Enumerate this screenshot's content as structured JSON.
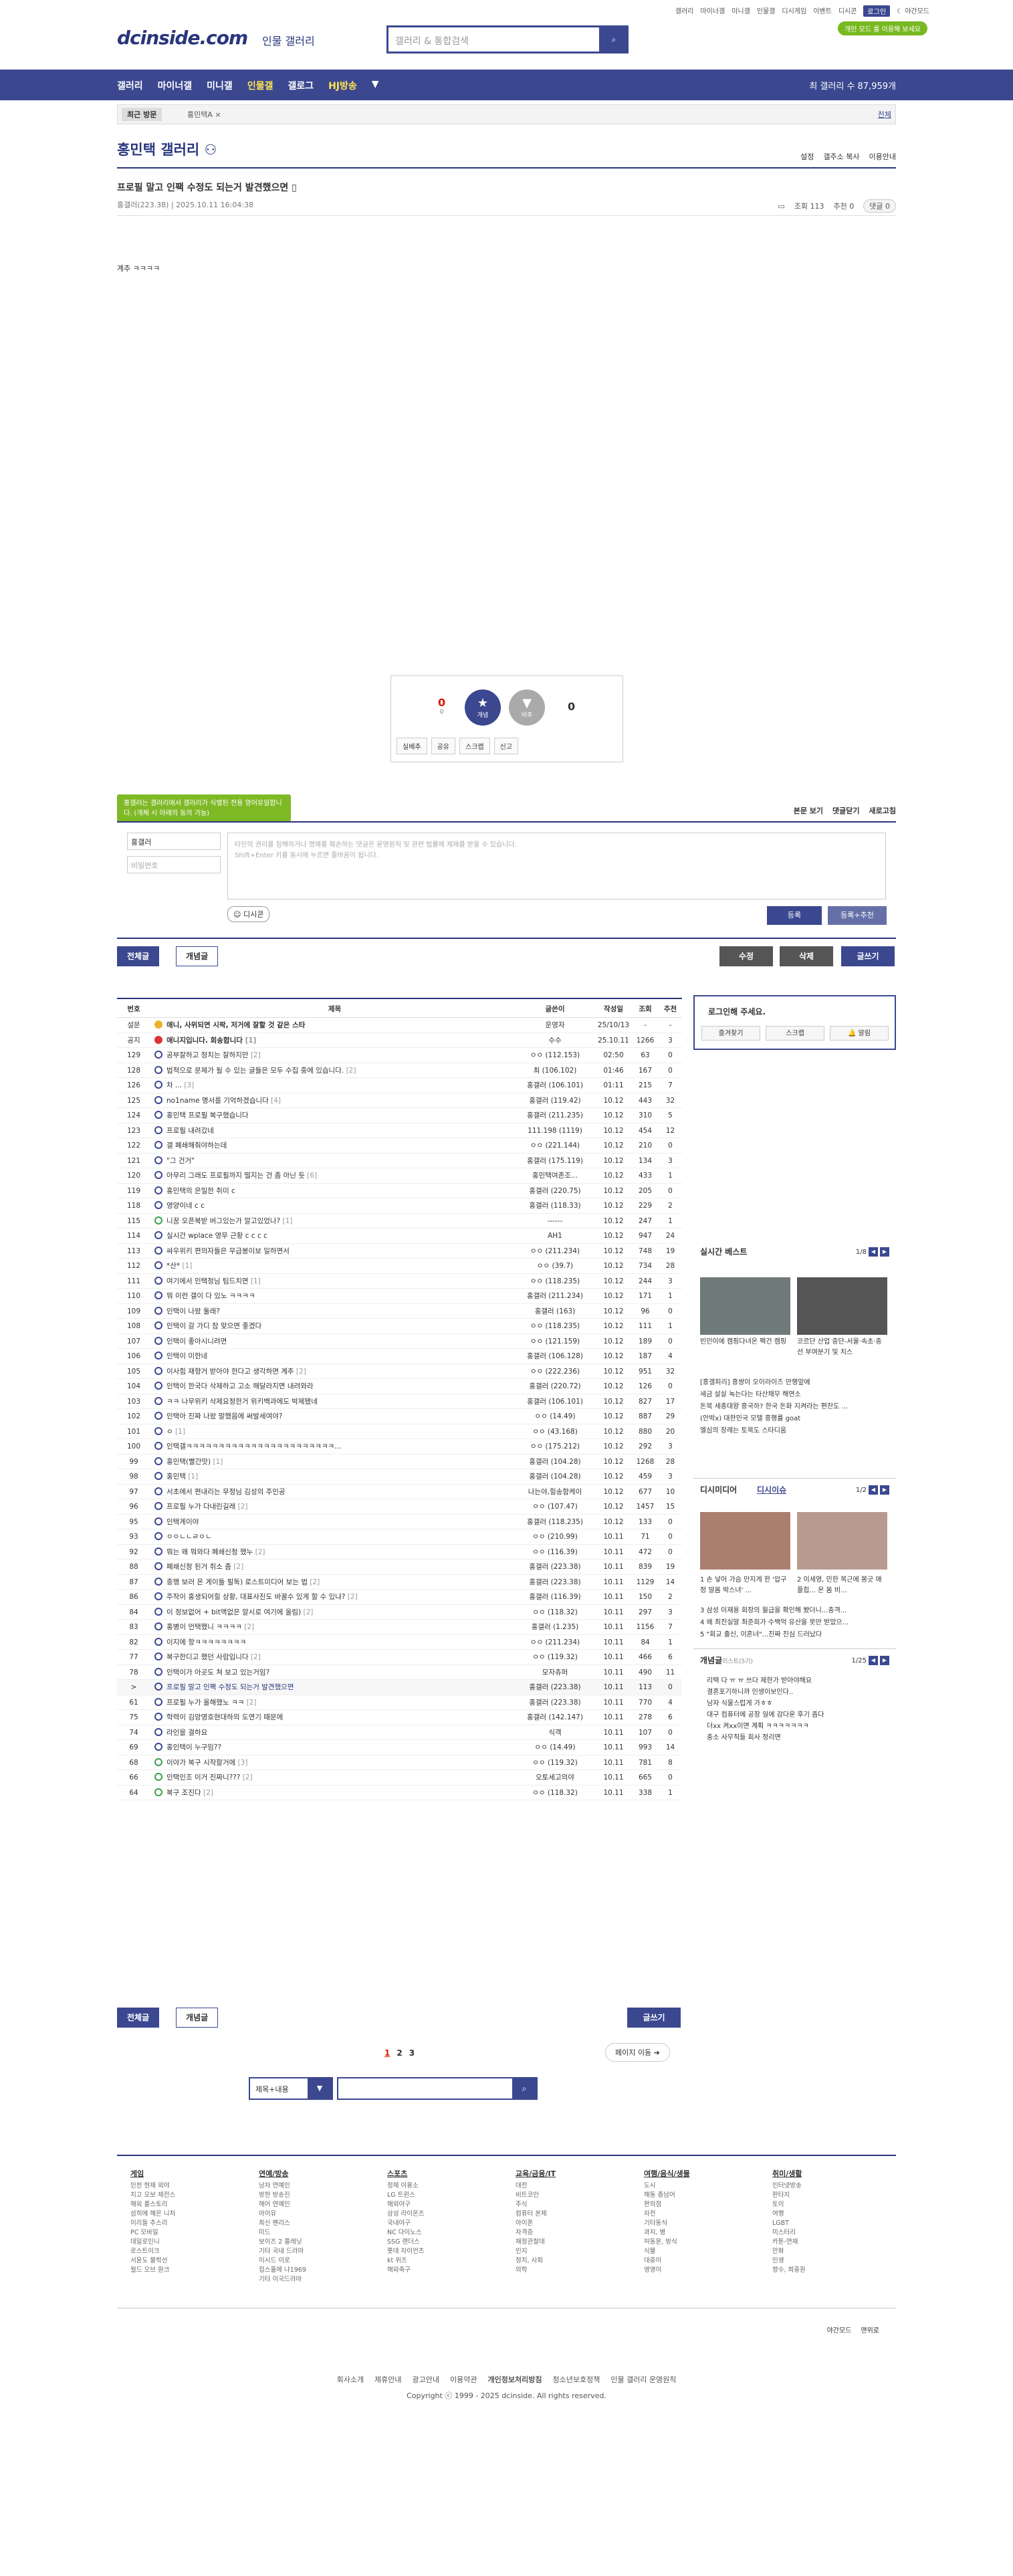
{
  "top": {
    "links": [
      "갤러리",
      "마이너갤",
      "미니갤",
      "인물갤",
      "디시게임",
      "이벤트",
      "디시콘"
    ],
    "login": "로그인",
    "night": "야간모드",
    "logo": "dcinside.com",
    "logo_sub": "인물 갤러리",
    "search_placeholder": "갤러리 & 통합검색",
    "badge": "개인 모드 를 이용해 보세요"
  },
  "nav": {
    "items": [
      "갤러리",
      "마이너갤",
      "미니갤",
      "인물갤",
      "갤로그",
      "HJ방송"
    ],
    "right": "최 갤러리 수 87,959개"
  },
  "subnav": {
    "recent": "최근 방문",
    "item": "홍민택A ×",
    "all": "전체"
  },
  "gallery": {
    "title": "홍민택 갤러리",
    "tools": [
      "설정",
      "갤주소 복사",
      "이용안내"
    ]
  },
  "post": {
    "title": "프로필 말고 인팩 수정도 되는거 발견했으면",
    "author": "홍갤러",
    "ip": "(223.38)",
    "date": "2025.10.11 16:04:38",
    "views": "조회 113",
    "recommend": "추천 0",
    "comments": "댓글 0",
    "body": "계추 ㅋㅋㅋㅋ"
  },
  "rec": {
    "up": "0",
    "up_fix": "0",
    "up_label": "개념",
    "down_label": "비추",
    "down": "0",
    "buttons": [
      "실베추",
      "공유",
      "스크랩",
      "신고"
    ]
  },
  "comment": {
    "tooltip": "홍갤러는 갤러리에서 갤러리가 식별된 전용 영어유일합니다. (개체 시 아래의 동의 가능)",
    "tools": [
      "본문 보기",
      "댓글닫기",
      "새로고침"
    ],
    "name": "홍갤러",
    "pw": "비밀번호",
    "placeholder": "타인의 권리를 침해하거나 명예를 훼손하는 댓글은 운영원칙 및 관련 법률에 제재를 받을 수 있습니다.\nShift+Enter 키를 동시에 누르면 줄바꿈이 됩니다.",
    "dccon": "디시콘",
    "register": "등록",
    "register2": "등록+추천"
  },
  "tabs": {
    "all": "전체글",
    "concept": "개념글",
    "edit": "수정",
    "delete": "삭제",
    "write": "글쓰기"
  },
  "table": {
    "headers": [
      "번호",
      "제목",
      "글쓴이",
      "작성일",
      "조회",
      "추천"
    ],
    "rows": [
      {
        "no": "설문",
        "icon": "o",
        "title": "애니, 사위되면 시팍, 저거에 잘할 것 같은 스타",
        "cmt": "",
        "writer": "운영자",
        "date": "25/10/13",
        "views": "-",
        "rec": "-",
        "b": true
      },
      {
        "no": "공지",
        "icon": "r",
        "title": "애니지입니다. 회송합니다",
        "cmt": "[1]",
        "writer": "수수",
        "date": "25.10.11",
        "views": "1266",
        "rec": "3",
        "b": true
      },
      {
        "no": "129",
        "icon": "",
        "title": "공부잘하고 정치는 잘하지만",
        "cmt": "[2]",
        "writer": "ㅇㅇ (112.153)",
        "date": "02:50",
        "views": "63",
        "rec": "0"
      },
      {
        "no": "128",
        "icon": "",
        "title": "법적으로 문제가 될 수 있는 글들은 모두 수집 중에 있습니다.",
        "cmt": "[2]",
        "writer": "최 (106.102)",
        "date": "01:46",
        "views": "167",
        "rec": "0"
      },
      {
        "no": "126",
        "icon": "",
        "title": "차 ...",
        "cmt": "[3]",
        "writer": "홍갤러 (106.101)",
        "date": "01:11",
        "views": "215",
        "rec": "7"
      },
      {
        "no": "125",
        "icon": "",
        "title": "no1name 명서를 기억하겠습니다",
        "cmt": "[4]",
        "writer": "홍갤러 (119.42)",
        "date": "10.12",
        "views": "443",
        "rec": "32"
      },
      {
        "no": "124",
        "icon": "",
        "title": "홍민택 프로필 복구했습니다",
        "cmt": "",
        "writer": "홍갤러 (211.235)",
        "date": "10.12",
        "views": "310",
        "rec": "5"
      },
      {
        "no": "123",
        "icon": "",
        "title": "프로필 내려갔네",
        "cmt": "",
        "writer": "111.198 (1119)",
        "date": "10.12",
        "views": "454",
        "rec": "12"
      },
      {
        "no": "122",
        "icon": "",
        "title": "갤 폐쇄해줘야하는데",
        "cmt": "",
        "writer": "ㅇㅇ (221.144)",
        "date": "10.12",
        "views": "210",
        "rec": "0"
      },
      {
        "no": "121",
        "icon": "",
        "title": "\"그 건거\"",
        "cmt": "",
        "writer": "홍갤러 (175.119)",
        "date": "10.12",
        "views": "134",
        "rec": "3"
      },
      {
        "no": "120",
        "icon": "",
        "title": "아무리 그래도 프로필까지 떨지는 건 좀 아닌 듯",
        "cmt": "[6]",
        "writer": "홍민택여존조...",
        "date": "10.12",
        "views": "433",
        "rec": "1"
      },
      {
        "no": "119",
        "icon": "",
        "title": "홍민택의 은밀한 취미 c",
        "cmt": "",
        "writer": "홍갤러 (220.75)",
        "date": "10.12",
        "views": "205",
        "rec": "0"
      },
      {
        "no": "118",
        "icon": "",
        "title": "영양이네 c c",
        "cmt": "",
        "writer": "홍갤러 (118.33)",
        "date": "10.12",
        "views": "229",
        "rec": "2"
      },
      {
        "no": "115",
        "icon": "g",
        "title": "니꿈 오픈북받 버그있는가 알고있었나?",
        "cmt": "[1]",
        "writer": "------",
        "date": "10.12",
        "views": "247",
        "rec": "1"
      },
      {
        "no": "114",
        "icon": "",
        "title": "실시간 wplace 영무 근황 c c c c",
        "cmt": "",
        "writer": "AH1",
        "date": "10.12",
        "views": "947",
        "rec": "24"
      },
      {
        "no": "113",
        "icon": "",
        "title": "싸우위키 편의자들은 무급봉이보 일하면서",
        "cmt": "",
        "writer": "ㅇㅇ (211.234)",
        "date": "10.12",
        "views": "748",
        "rec": "19"
      },
      {
        "no": "112",
        "icon": "",
        "title": "*산*",
        "cmt": "[1]",
        "writer": "ㅇㅇ (39.7)",
        "date": "10.12",
        "views": "734",
        "rec": "28"
      },
      {
        "no": "111",
        "icon": "",
        "title": "여기에서 인택정님 팀드치면",
        "cmt": "[1]",
        "writer": "ㅇㅇ (118.235)",
        "date": "10.12",
        "views": "244",
        "rec": "3"
      },
      {
        "no": "110",
        "icon": "",
        "title": "뭐 이런 갤이 다 있노 ㅋㅋㅋㅋ",
        "cmt": "",
        "writer": "홍갤러 (211.234)",
        "date": "10.12",
        "views": "171",
        "rec": "1"
      },
      {
        "no": "109",
        "icon": "",
        "title": "인택이 나왔 둘래?",
        "cmt": "",
        "writer": "홍갤러 (163)",
        "date": "10.12",
        "views": "96",
        "rec": "0"
      },
      {
        "no": "108",
        "icon": "",
        "title": "인택이 갈 가디 참 맞으면 좋겠다",
        "cmt": "",
        "writer": "ㅇㅇ (118.235)",
        "date": "10.12",
        "views": "111",
        "rec": "1"
      },
      {
        "no": "107",
        "icon": "",
        "title": "인택이 좋아시니려면",
        "cmt": "",
        "writer": "ㅇㅇ (121.159)",
        "date": "10.12",
        "views": "189",
        "rec": "0"
      },
      {
        "no": "106",
        "icon": "",
        "title": "인택이 미한네",
        "cmt": "",
        "writer": "홍갤러 (106.128)",
        "date": "10.12",
        "views": "187",
        "rec": "4"
      },
      {
        "no": "105",
        "icon": "",
        "title": "이사힘 재향거 받아야 한다고 생각하면 계추",
        "cmt": "[2]",
        "writer": "ㅇㅇ (222.236)",
        "date": "10.12",
        "views": "951",
        "rec": "32"
      },
      {
        "no": "104",
        "icon": "",
        "title": "인택이 한국다 삭제하고 고소 해달라지면 내려와라",
        "cmt": "",
        "writer": "홍갤러 (220.72)",
        "date": "10.12",
        "views": "126",
        "rec": "0"
      },
      {
        "no": "103",
        "icon": "",
        "title": "ㅋㅋ 나무위키 삭제요청한거 위키백과에도 박제됐네",
        "cmt": "",
        "writer": "홍갤러 (106.101)",
        "date": "10.12",
        "views": "827",
        "rec": "17"
      },
      {
        "no": "102",
        "icon": "",
        "title": "인택아 진짜 나왔 말했음에 써발세여야?",
        "cmt": "",
        "writer": "ㅇㅇ (14.49)",
        "date": "10.12",
        "views": "887",
        "rec": "29"
      },
      {
        "no": "101",
        "icon": "",
        "title": "ㅇ",
        "cmt": "[1]",
        "writer": "ㅇㅇ (43.168)",
        "date": "10.12",
        "views": "880",
        "rec": "20"
      },
      {
        "no": "100",
        "icon": "",
        "title": "인택갤ㅋㅋㅋㅋㅋㅋㅋㅋㅋㅋㅋㅋㅋㅋㅋㅋㅋㅋㅋㅋㅋㅋㅋ...",
        "cmt": "",
        "writer": "ㅇㅇ (175.212)",
        "date": "10.12",
        "views": "292",
        "rec": "3"
      },
      {
        "no": "99",
        "icon": "",
        "title": "홍민택(빨간맛)",
        "cmt": "[1]",
        "writer": "홍갤러 (104.28)",
        "date": "10.12",
        "views": "1268",
        "rec": "28"
      },
      {
        "no": "98",
        "icon": "",
        "title": "홍민택",
        "cmt": "[1]",
        "writer": "홍갤러 (104.28)",
        "date": "10.12",
        "views": "459",
        "rec": "3"
      },
      {
        "no": "97",
        "icon": "",
        "title": "서초에서 편내리는 무정님 김성의 주인공",
        "cmt": "",
        "writer": "나는야,힐송함케이",
        "date": "10.12",
        "views": "677",
        "rec": "10"
      },
      {
        "no": "96",
        "icon": "",
        "title": "프로필 누가 다내린길래",
        "cmt": "[2]",
        "writer": "ㅇㅇ (107.47)",
        "date": "10.12",
        "views": "1457",
        "rec": "15"
      },
      {
        "no": "95",
        "icon": "",
        "title": "인택게이야",
        "cmt": "",
        "writer": "홍갤러 (118.235)",
        "date": "10.12",
        "views": "133",
        "rec": "0"
      },
      {
        "no": "93",
        "icon": "",
        "title": "ㅇㅇㄴㄴㄹㅇㄴ",
        "cmt": "",
        "writer": "ㅇㅇ (210.99)",
        "date": "10.11",
        "views": "71",
        "rec": "0"
      },
      {
        "no": "92",
        "icon": "",
        "title": "뭐는 왜 뭐와다 폐쇄신청 했누",
        "cmt": "[2]",
        "writer": "ㅇㅇ (116.39)",
        "date": "10.11",
        "views": "472",
        "rec": "0"
      },
      {
        "no": "88",
        "icon": "",
        "title": "폐쇄신청 된거 취소 좀",
        "cmt": "[2]",
        "writer": "홍갤러 (223.38)",
        "date": "10.11",
        "views": "839",
        "rec": "19"
      },
      {
        "no": "87",
        "icon": "",
        "title": "중행 보러 온 게이들 필독) 로스트미디어 보는 법",
        "cmt": "[2]",
        "writer": "홍갤러 (223.38)",
        "date": "10.11",
        "views": "1129",
        "rec": "14"
      },
      {
        "no": "86",
        "icon": "",
        "title": "주작이 홍생되어힐 상황, 대표사진도 바꿀수 있게 할 수 있냐?",
        "cmt": "[2]",
        "writer": "홍갤러 (116.39)",
        "date": "10.11",
        "views": "150",
        "rec": "2"
      },
      {
        "no": "84",
        "icon": "",
        "title": "이 정보없어 + bit맥없은 알시로 여기에 올림)",
        "cmt": "[2]",
        "writer": "ㅇㅇ (118.32)",
        "date": "10.11",
        "views": "297",
        "rec": "3"
      },
      {
        "no": "83",
        "icon": "",
        "title": "홍병이 언택했니 ㅋㅋㅋㅋ",
        "cmt": "[2]",
        "writer": "홍갤러 (1.235)",
        "date": "10.11",
        "views": "1156",
        "rec": "7"
      },
      {
        "no": "82",
        "icon": "",
        "title": "이지에 항ㅋㅋㅋㅋㅋㅋㅋㅋ",
        "cmt": "",
        "writer": "ㅇㅇ (211.234)",
        "date": "10.11",
        "views": "84",
        "rec": "1"
      },
      {
        "no": "77",
        "icon": "",
        "title": "복구한디고 했던 사람입니다",
        "cmt": "[2]",
        "writer": "ㅇㅇ (119.32)",
        "date": "10.11",
        "views": "466",
        "rec": "6"
      },
      {
        "no": "78",
        "icon": "",
        "title": "인택이가 아곳도 쳐 보고 있는거임?",
        "cmt": "",
        "writer": "모자츄퍼",
        "date": "10.11",
        "views": "490",
        "rec": "11"
      },
      {
        "no": ">",
        "icon": "",
        "title": "프로필 말고 인팩 수정도 되는거 발견했으면",
        "cmt": "",
        "writer": "홍갤러 (223.38)",
        "date": "10.11",
        "views": "113",
        "rec": "0",
        "hl": true
      },
      {
        "no": "61",
        "icon": "",
        "title": "프로필 누가 올해했노 ㅋㅋ",
        "cmt": "[2]",
        "writer": "홍갤러 (223.38)",
        "date": "10.11",
        "views": "770",
        "rec": "4"
      },
      {
        "no": "75",
        "icon": "",
        "title": "학력이 김앙영호현대하의 도연기 때문에",
        "cmt": "",
        "writer": "홍갤러 (142.147)",
        "date": "10.11",
        "views": "278",
        "rec": "6"
      },
      {
        "no": "74",
        "icon": "",
        "title": "라인을 결하요",
        "cmt": "",
        "writer": "식객",
        "date": "10.11",
        "views": "107",
        "rec": "0"
      },
      {
        "no": "69",
        "icon": "",
        "title": "홍인택이 누구임??",
        "cmt": "",
        "writer": "ㅇㅇ (14.49)",
        "date": "10.11",
        "views": "993",
        "rec": "14"
      },
      {
        "no": "68",
        "icon": "g",
        "title": "이야가 복구 시작할거에",
        "cmt": "[3]",
        "writer": "ㅇㅇ (119.32)",
        "date": "10.11",
        "views": "781",
        "rec": "8"
      },
      {
        "no": "66",
        "icon": "g",
        "title": "인택인조 이거 진짜니???",
        "cmt": "[2]",
        "writer": "오토세고의야",
        "date": "10.11",
        "views": "665",
        "rec": "0"
      },
      {
        "no": "64",
        "icon": "g",
        "title": "복구 조진다",
        "cmt": "[2]",
        "writer": "ㅇㅇ (118.32)",
        "date": "10.11",
        "views": "338",
        "rec": "1"
      }
    ]
  },
  "sidebar": {
    "login_title": "로그인해 주세요.",
    "login_btns": [
      "즐겨찾기",
      "스크랩",
      "알림"
    ],
    "best_title": "실시간 베스트",
    "best_page": "1/8",
    "best_caps": [
      "빈민이에 캠핑다녀온 펙건 캠핑",
      "코르단 산업 중단-서울·속초·충선 부여분기 및 치스"
    ],
    "best_list": [
      "[흥갤피리] 흥쌍이 오이라이즈 만행앞에",
      "세금 살살 녹는다는 타산채무 해연소",
      "돈북 세종대왕 흥국하? 한국 돈화 지켜라는 편찬도 ...",
      "(안박x) 대한민국 모텔 흥행를 goat",
      "엘심의 장례는 토목도 스타디움"
    ],
    "dc_title1": "디시미디어",
    "dc_title2": "디시이슈",
    "dc_page": "1/2",
    "dc_caps": [
      "1 손 넣어 가슴 만지게 한 '압구정 알몸 박스녀' ...",
      "2 이세영, 민한 복근에 봉긋 애플힙... 온 몸 비..."
    ],
    "dc_list": [
      "3 삼성 이재용 회장의 월급을 확인해 봤더니...충격...",
      "4 왜 최진실말 최준희가 수백억 유산을 못만 받았으...",
      "5 \"회교 출신, 이혼녀\"...진짜 진심 드러났다"
    ],
    "concept_title": "개념글",
    "concept_sub": "리스트(5기)",
    "concept_page": "1/25",
    "concept_list": [
      "리택 다 ㅠ ㅠ 쓰다 제한가 받아야해요",
      "결혼포기하니까 인생이보인다..",
      "남자 식물스럽게 가ㅎㅎ",
      "대구 컴퓨터에 공장 일에 감다운 후기 좀다",
      "더xx 켜xx이면 계획 ㅋㅋㅋㅋㅋㅋㅋ",
      "충소 사무직들 회사 정리면"
    ]
  },
  "pages": [
    "1",
    "2",
    "3"
  ],
  "page_move": "페이지 이동",
  "bottom_search": {
    "select": "제목+내용"
  },
  "footer": {
    "cols": [
      {
        "title": "게임",
        "items": [
          "인천 현재 외야",
          "치고 오보 제전스",
          "해외 플스토리",
          "섬히에 해은 니처",
          "이리들 추스리",
          "PC 모바일",
          "데일로인니",
          "로스트이크",
          "서윤도 물학선",
          "월드 오브 원크"
        ]
      },
      {
        "title": "연예/방송",
        "items": [
          "남자 연예인",
          "방한 방송진",
          "해어 연예인",
          "아이유",
          "최신 팬리스",
          "미드",
          "보이즈 2 플레닛",
          "기타 국내 드라마",
          "이시드 이로",
          "접스홀에 냐1969",
          "기타 이국드라마"
        ]
      },
      {
        "title": "스포츠",
        "items": [
          "정체 이용소",
          "LG 트윈스",
          "해외야구",
          "삼성 라이온즈",
          "국내야구",
          "NC 다이노스",
          "SSG 랜더스",
          "롯데 자이언츠",
          "kt 위즈",
          "해외축구"
        ]
      },
      {
        "title": "교육/금융/IT",
        "items": [
          "대전",
          "비트코인",
          "주식",
          "컴퓨터 본체",
          "아이폰",
          "자격증",
          "재정관찰데",
          "인지",
          "정치, 사회",
          "의학"
        ]
      },
      {
        "title": "여행/음식/생물",
        "items": [
          "도시",
          "해동 충남어",
          "편의점",
          "자전",
          "기타동식",
          "과지, 병",
          "허동운, 방식",
          "식물",
          "대중이",
          "영영이"
        ]
      },
      {
        "title": "취미/생활",
        "items": [
          "인터넷방송",
          "판타지",
          "토이",
          "여행",
          "LGBT",
          "미스터리",
          "카툰-연재",
          "만화",
          "인생",
          "향수, 희중원"
        ]
      }
    ],
    "bottom_right": [
      "야간모드",
      "맨위로"
    ],
    "links": [
      "회사소개",
      "제휴안내",
      "광고안내",
      "이용약관",
      "개인정보처리방침",
      "청소년보호정책",
      "인물 갤러리 운영원칙"
    ],
    "copyright": "Copyright ⓒ 1999 - 2025 dcinside. All rights reserved."
  }
}
